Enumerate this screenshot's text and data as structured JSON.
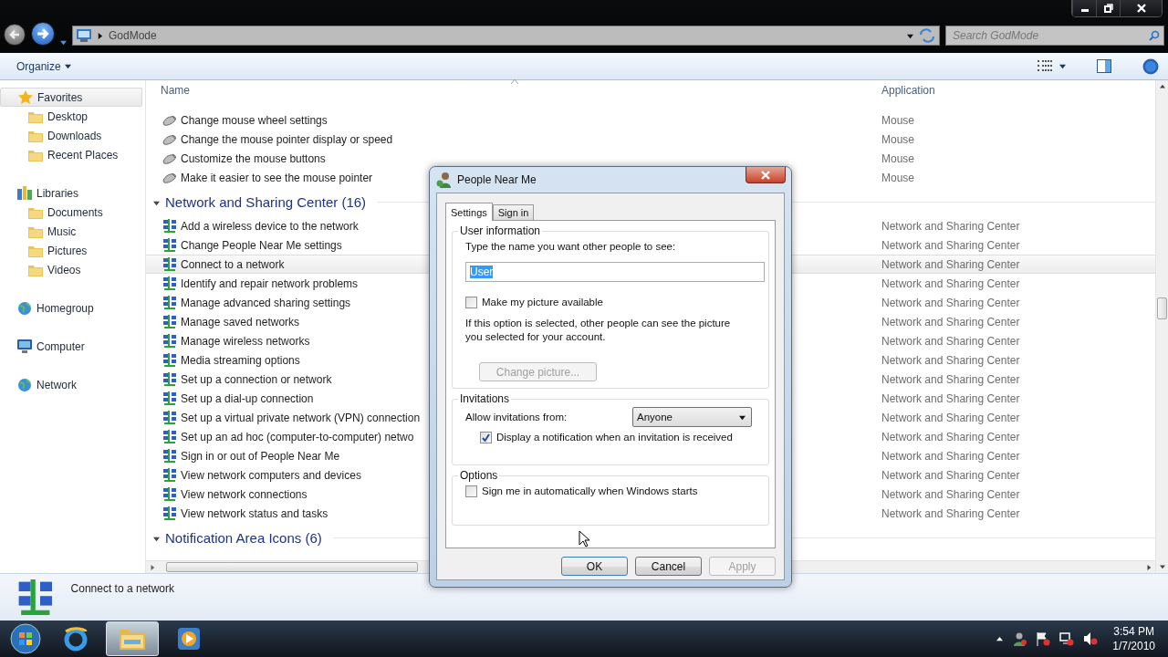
{
  "window": {
    "address": "GodMode",
    "search_placeholder": "Search GodMode"
  },
  "toolbar": {
    "organize": "Organize"
  },
  "sidebar": [
    {
      "label": "Favorites",
      "selected": true,
      "children": [
        {
          "label": "Desktop",
          "selected": false
        },
        {
          "label": "Downloads",
          "selected": false
        },
        {
          "label": "Recent Places",
          "selected": false
        }
      ]
    },
    {
      "label": "Libraries",
      "selected": false,
      "children": [
        {
          "label": "Documents",
          "selected": false
        },
        {
          "label": "Music",
          "selected": false
        },
        {
          "label": "Pictures",
          "selected": false
        },
        {
          "label": "Videos",
          "selected": false
        }
      ]
    },
    {
      "label": "Homegroup",
      "selected": false
    },
    {
      "label": "Computer",
      "selected": false
    },
    {
      "label": "Network",
      "selected": false
    }
  ],
  "columns": [
    "Name",
    "Application"
  ],
  "groups": [
    {
      "kind": "mouse",
      "rows": [
        {
          "name": "Change mouse wheel settings",
          "application": "Mouse",
          "selected": false
        },
        {
          "name": "Change the mouse pointer display or speed",
          "application": "Mouse",
          "selected": false
        },
        {
          "name": "Customize the mouse buttons",
          "application": "Mouse",
          "selected": false
        },
        {
          "name": "Make it easier to see the mouse pointer",
          "application": "Mouse",
          "selected": false
        }
      ]
    },
    {
      "kind": "network",
      "title": "Network and Sharing Center (16)",
      "expanded": true,
      "rows": [
        {
          "name": "Add a wireless device to the network",
          "application": "Network and Sharing Center",
          "selected": false
        },
        {
          "name": "Change People Near Me settings",
          "application": "Network and Sharing Center",
          "selected": false
        },
        {
          "name": "Connect to a network",
          "application": "Network and Sharing Center",
          "selected": true
        },
        {
          "name": "Identify and repair network problems",
          "application": "Network and Sharing Center",
          "selected": false
        },
        {
          "name": "Manage advanced sharing settings",
          "application": "Network and Sharing Center",
          "selected": false
        },
        {
          "name": "Manage saved networks",
          "application": "Network and Sharing Center",
          "selected": false
        },
        {
          "name": "Manage wireless networks",
          "application": "Network and Sharing Center",
          "selected": false
        },
        {
          "name": "Media streaming options",
          "application": "Network and Sharing Center",
          "selected": false
        },
        {
          "name": "Set up a connection or network",
          "application": "Network and Sharing Center",
          "selected": false
        },
        {
          "name": "Set up a dial-up connection",
          "application": "Network and Sharing Center",
          "selected": false
        },
        {
          "name": "Set up a virtual private network (VPN) connection",
          "application": "Network and Sharing Center",
          "selected": false
        },
        {
          "name": "Set up an ad hoc (computer-to-computer) netwo",
          "application": "Network and Sharing Center",
          "selected": false
        },
        {
          "name": "Sign in or out of People Near Me",
          "application": "Network and Sharing Center",
          "selected": false
        },
        {
          "name": "View network computers and devices",
          "application": "Network and Sharing Center",
          "selected": false
        },
        {
          "name": "View network connections",
          "application": "Network and Sharing Center",
          "selected": false
        },
        {
          "name": "View network status and tasks",
          "application": "Network and Sharing Center",
          "selected": false
        }
      ]
    },
    {
      "title": "Notification Area Icons (6)",
      "expanded": true
    }
  ],
  "details": {
    "title": "Connect to a network"
  },
  "dialog": {
    "title": "People Near Me",
    "tabs": [
      {
        "label": "Settings",
        "selected": true
      },
      {
        "label": "Sign in",
        "selected": false
      }
    ],
    "user_info": {
      "legend": "User information",
      "prompt": "Type the name you want other people to see:",
      "name_value": "User",
      "name_text_selected": true,
      "picture_checkbox": {
        "label": "Make my picture available",
        "checked": false
      },
      "note": "If this option is selected, other people can see the picture you selected for your account.",
      "change_button": {
        "label": "Change picture...",
        "disabled": true
      }
    },
    "invitations": {
      "legend": "Invitations",
      "allow_label": "Allow invitations from:",
      "allow_value": "Anyone",
      "notify_checkbox": {
        "label": "Display a notification when an invitation is received",
        "checked": true
      }
    },
    "options": {
      "legend": "Options",
      "auto_checkbox": {
        "label": "Sign me in automatically when Windows starts",
        "checked": false
      }
    },
    "buttons": [
      {
        "label": "OK",
        "default": true,
        "disabled": false
      },
      {
        "label": "Cancel",
        "default": false,
        "disabled": false
      },
      {
        "label": "Apply",
        "default": false,
        "disabled": true
      }
    ]
  },
  "taskbar": {
    "apps": [
      {
        "kind": "browser",
        "selected": false
      },
      {
        "kind": "explorer",
        "selected": true
      },
      {
        "kind": "media",
        "selected": false
      }
    ],
    "time": "3:54 PM",
    "date": "1/7/2010"
  }
}
